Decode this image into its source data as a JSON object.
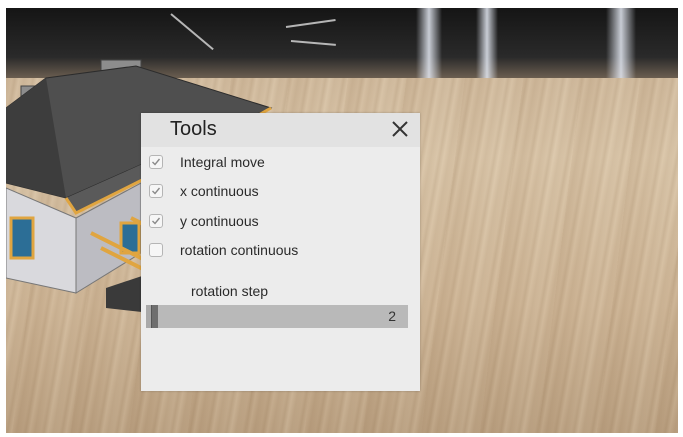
{
  "panel": {
    "title": "Tools",
    "options": [
      {
        "label": "Integral move",
        "checked": true
      },
      {
        "label": "x continuous",
        "checked": true
      },
      {
        "label": "y continuous",
        "checked": true
      },
      {
        "label": "rotation continuous",
        "checked": false
      }
    ],
    "rotation_step": {
      "label": "rotation step",
      "value": "2",
      "fill_fraction": 0.02
    }
  },
  "icons": {
    "close": "close-icon",
    "check": "checkmark-icon"
  },
  "colors": {
    "panel_bg": "#ececec",
    "header_bg": "#e2e2e2",
    "slider_track": "#b9b9b9",
    "slider_handle": "#6e6e6e"
  }
}
